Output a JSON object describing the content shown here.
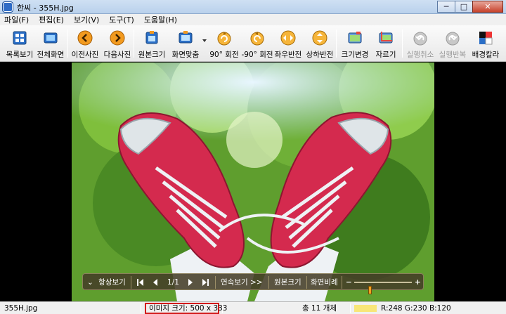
{
  "window": {
    "title": "한씨 - 355H.jpg",
    "controls": {
      "minimize": "─",
      "maximize": "□",
      "close": "✕"
    }
  },
  "menu": [
    "파일(F)",
    "편집(E)",
    "보기(V)",
    "도구(T)",
    "도움말(H)"
  ],
  "toolbar": {
    "list_view": "목록보기",
    "fullscreen": "전체화면",
    "prev_photo": "이전사진",
    "next_photo": "다음사진",
    "original_size": "원본크기",
    "fit_screen": "화면맞춤",
    "rotate_90": "90° 회전",
    "rotate_neg90": "-90° 회전",
    "flip_horizontal": "좌우반전",
    "flip_vertical": "상하반전",
    "resize": "크기변경",
    "crop": "자르기",
    "undo": "실행취소",
    "redo": "실행반복",
    "background_color": "배경칼라"
  },
  "floatbar": {
    "always_show": "항상보기",
    "page": "1/1",
    "slideshow": "연속보기 >>",
    "original_size": "원본크기",
    "screen_ratio": "화면비례",
    "zoom_level": 0.26
  },
  "status": {
    "filename": "355H.jpg",
    "image_size": "이미지 크기: 500 x 333",
    "total": "총 11 개체",
    "pixel_color": "#f8e678",
    "rgb": "R:248 G:230 B:120"
  },
  "colors": {
    "accent_orange": "#f29a1f",
    "highlight_border": "#d21a1a"
  }
}
